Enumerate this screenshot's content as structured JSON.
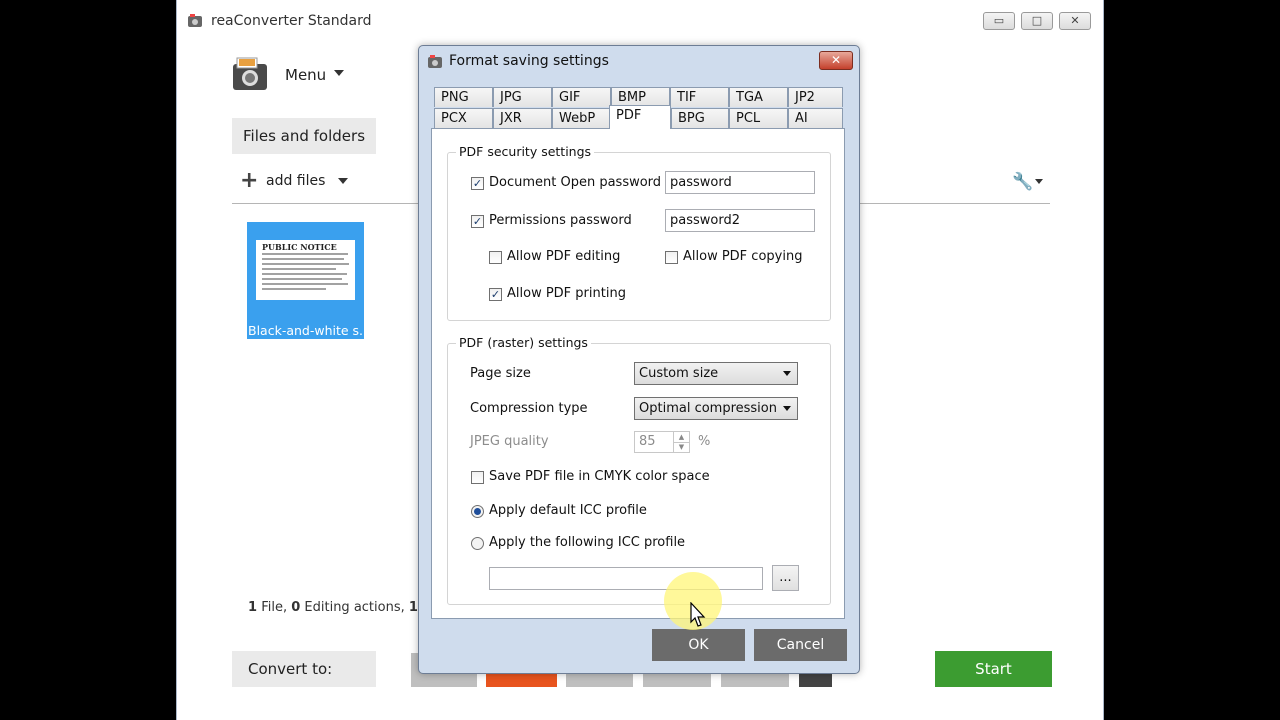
{
  "app": {
    "title": "reaConverter Standard",
    "menu_label": "Menu",
    "files_tab": "Files and folders",
    "add_files": "add files",
    "thumbnail": {
      "label": "Black-and-white s...",
      "doc_heading": "PUBLIC NOTICE"
    },
    "status": {
      "files_count": "1",
      "files_label": "File,",
      "edit_count": "0",
      "edit_label": "Editing actions,",
      "extra": "1"
    },
    "convert_to": "Convert to:",
    "start": "Start",
    "window_buttons": {
      "minimize": "▭",
      "maximize": "□",
      "close": "✕"
    }
  },
  "dialog": {
    "title": "Format saving settings",
    "close_label": "✕",
    "tabs_row1": [
      "PNG",
      "JPG",
      "GIF",
      "BMP",
      "TIF",
      "TGA",
      "JP2"
    ],
    "tabs_row2": [
      "PCX",
      "JXR",
      "WebP",
      "PDF",
      "BPG",
      "PCL",
      "AI"
    ],
    "active_tab": "PDF",
    "security": {
      "group_title": "PDF security settings",
      "open_pw_label": "Document Open password",
      "open_pw_value": "password",
      "perm_pw_label": "Permissions password",
      "perm_pw_value": "password2",
      "allow_editing": "Allow PDF editing",
      "allow_copying": "Allow PDF copying",
      "allow_printing": "Allow PDF printing",
      "checkmark": "✓"
    },
    "raster": {
      "group_title": "PDF (raster) settings",
      "page_size_label": "Page size",
      "page_size_value": "Custom size",
      "compression_label": "Compression type",
      "compression_value": "Optimal compression",
      "jpeg_label": "JPEG quality",
      "jpeg_value": "85",
      "jpeg_unit": "%",
      "cmyk_label": "Save PDF file in CMYK color space",
      "icc_default": "Apply default ICC profile",
      "icc_following": "Apply the following ICC profile",
      "icc_path": "",
      "browse_label": "..."
    },
    "ok": "OK",
    "cancel": "Cancel"
  },
  "colors": {
    "accent_orange": "#e8541e",
    "start_green": "#3c9c31",
    "thumb_blue": "#3aa0ee"
  }
}
